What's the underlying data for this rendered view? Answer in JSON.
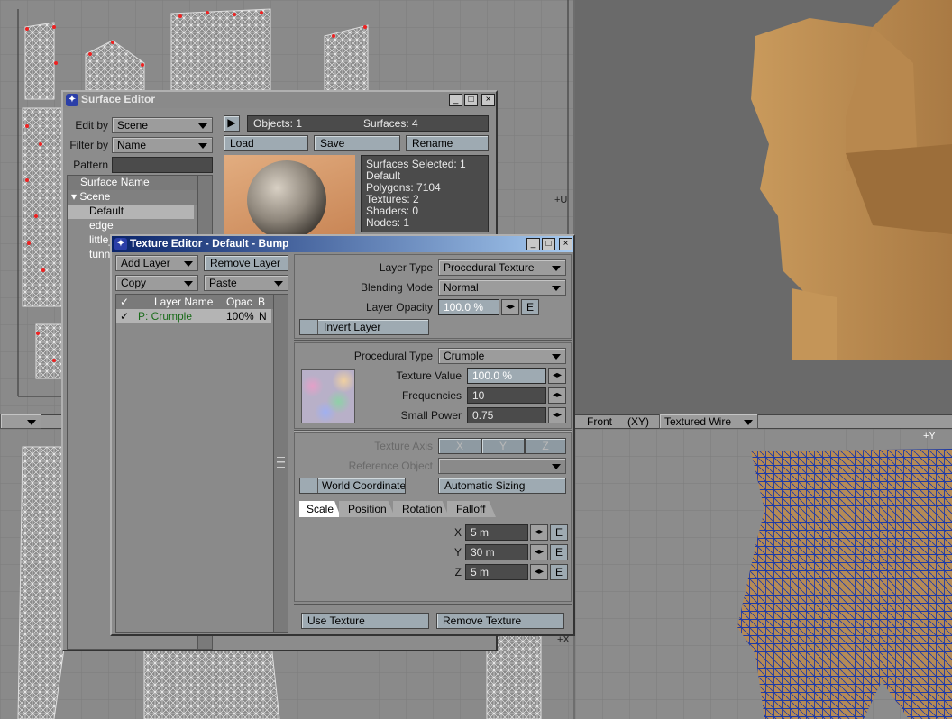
{
  "viewports": {
    "bottom_bar": {
      "view_label": "Front",
      "axis_label": "(XY)",
      "render_mode": "Textured Wire"
    },
    "axis_top": "+U",
    "axis_y": "+Y",
    "axis_x": "+X"
  },
  "surface_editor": {
    "title": "Surface Editor",
    "edit_by_label": "Edit by",
    "edit_by_value": "Scene",
    "filter_by_label": "Filter by",
    "filter_by_value": "Name",
    "pattern_label": "Pattern",
    "pattern_value": "",
    "objects": "Objects: 1",
    "surfaces": "Surfaces: 4",
    "load": "Load",
    "save": "Save",
    "rename": "Rename",
    "list_header": "Surface Name",
    "tree_root": "Scene",
    "items": [
      "Default",
      "edge",
      "little_",
      "tunne"
    ],
    "info": [
      "Surfaces Selected: 1",
      "Default",
      "Polygons: 7104",
      "Textures: 2",
      "Shaders: 0",
      "Nodes: 1"
    ]
  },
  "texture_editor": {
    "title": "Texture Editor - Default - Bump",
    "add_layer": "Add Layer",
    "remove_layer": "Remove Layer",
    "copy": "Copy",
    "paste": "Paste",
    "col_layer_name": "Layer Name",
    "col_opac": "Opac",
    "col_b": "B",
    "check": "✓",
    "layers": [
      {
        "name": "P: Crumple",
        "opac": "100%",
        "blend": "N"
      }
    ],
    "layer_type_label": "Layer Type",
    "layer_type_value": "Procedural Texture",
    "blending_mode_label": "Blending Mode",
    "blending_mode_value": "Normal",
    "layer_opacity_label": "Layer Opacity",
    "layer_opacity_value": "100.0 %",
    "e": "E",
    "invert_layer": "Invert Layer",
    "procedural_type_label": "Procedural Type",
    "procedural_type_value": "Crumple",
    "texture_value_label": "Texture Value",
    "texture_value": "100.0 %",
    "frequencies_label": "Frequencies",
    "frequencies_value": "10",
    "small_power_label": "Small Power",
    "small_power_value": "0.75",
    "texture_axis_label": "Texture Axis",
    "axis_x": "X",
    "axis_y": "Y",
    "axis_z": "Z",
    "reference_object_label": "Reference Object",
    "world_coordinates": "World Coordinates",
    "automatic_sizing": "Automatic Sizing",
    "tabs": [
      "Scale",
      "Position",
      "Rotation",
      "Falloff"
    ],
    "scale": {
      "x_label": "X",
      "x_value": "5 m",
      "y_label": "Y",
      "y_value": "30 m",
      "z_label": "Z",
      "z_value": "5 m"
    },
    "use_texture": "Use Texture",
    "remove_texture": "Remove Texture"
  }
}
